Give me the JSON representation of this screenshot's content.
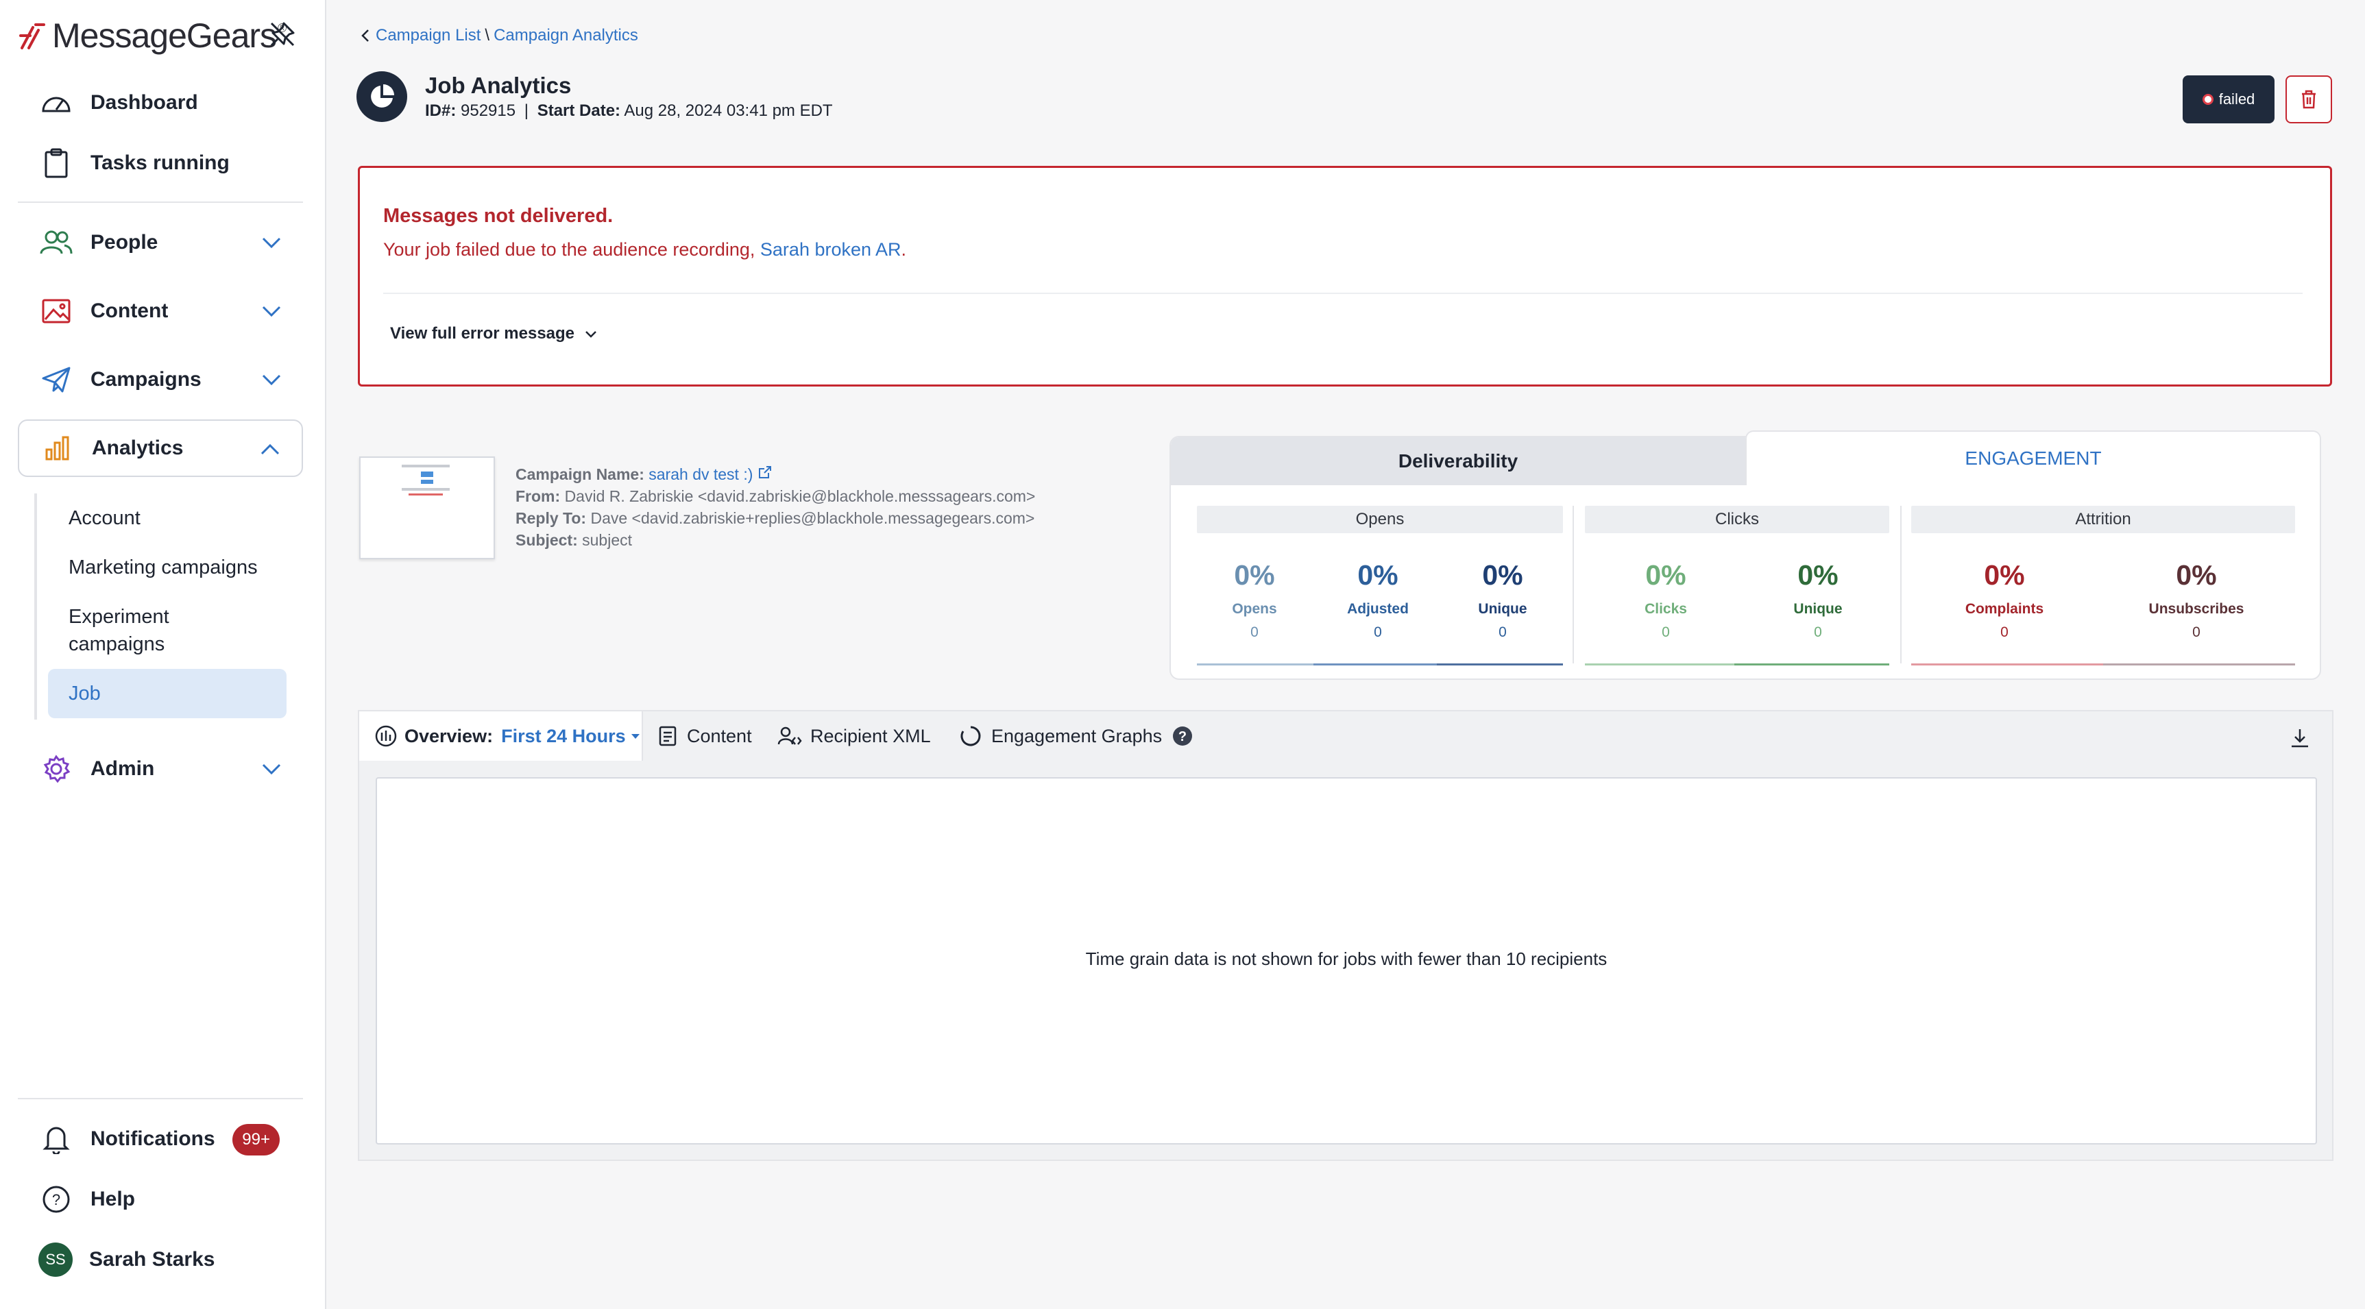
{
  "app": {
    "brand": "MessageGears",
    "brand_tm": "®"
  },
  "sidebar": {
    "top_items": [
      {
        "label": "Dashboard",
        "icon": "gauge-icon"
      },
      {
        "label": "Tasks running",
        "icon": "clipboard-icon"
      }
    ],
    "sections": [
      {
        "label": "People",
        "icon": "people-icon",
        "expanded": false
      },
      {
        "label": "Content",
        "icon": "image-icon",
        "expanded": false
      },
      {
        "label": "Campaigns",
        "icon": "paper-plane-icon",
        "expanded": false
      },
      {
        "label": "Analytics",
        "icon": "bar-chart-icon",
        "expanded": true
      },
      {
        "label": "Admin",
        "icon": "gear-icon",
        "expanded": false
      }
    ],
    "analytics_sub": [
      {
        "label": "Account"
      },
      {
        "label": "Marketing campaigns"
      },
      {
        "label": "Experiment campaigns"
      },
      {
        "label": "Job",
        "active": true
      }
    ],
    "bottom": {
      "notifications": "Notifications",
      "notifications_badge": "99+",
      "help": "Help",
      "user_initials": "SS",
      "user_name": "Sarah Starks"
    }
  },
  "breadcrumb": {
    "campaign_list": "Campaign List",
    "sep": "\\",
    "campaign_analytics": "Campaign Analytics"
  },
  "header": {
    "title": "Job Analytics",
    "id_label": "ID#:",
    "id_value": "952915",
    "meta_sep": "|",
    "start_label": "Start Date:",
    "start_value": "Aug 28, 2024 03:41 pm EDT",
    "status": "failed"
  },
  "error": {
    "title": "Messages not delivered.",
    "text_prefix": "Your job failed due to the audience recording, ",
    "link": "Sarah broken AR",
    "text_suffix": ".",
    "toggle": "View full error message"
  },
  "campaign": {
    "name_label": "Campaign Name:",
    "name_value": "sarah dv test :)",
    "from_label": "From:",
    "from_value": "David R. Zabriskie <david.zabriskie@blackhole.messsagears.com>",
    "reply_label": "Reply To:",
    "reply_value": "Dave <david.zabriskie+replies@blackhole.messagegears.com>",
    "subject_label": "Subject:",
    "subject_value": "subject"
  },
  "stats": {
    "tab_deliverability": "Deliverability",
    "tab_engagement": "ENGAGEMENT",
    "groups": [
      {
        "label": "Opens"
      },
      {
        "label": "Clicks"
      },
      {
        "label": "Attrition"
      }
    ],
    "items": [
      {
        "pct": "0%",
        "name": "Opens",
        "count": "0",
        "color": "#6a8fb0"
      },
      {
        "pct": "0%",
        "name": "Adjusted",
        "count": "0",
        "color": "#2d5f9a"
      },
      {
        "pct": "0%",
        "name": "Unique",
        "count": "0",
        "color": "#1f3f73"
      },
      {
        "pct": "0%",
        "name": "Clicks",
        "count": "0",
        "color": "#6fae7a"
      },
      {
        "pct": "0%",
        "name": "Unique",
        "count": "0",
        "color": "#2f6b3a"
      },
      {
        "pct": "0%",
        "name": "Complaints",
        "count": "0",
        "color": "#a3242b"
      },
      {
        "pct": "0%",
        "name": "Unsubscribes",
        "count": "0",
        "color": "#5a3136"
      }
    ]
  },
  "bottom_tabs": {
    "overview_label": "Overview:",
    "overview_value": "First 24 Hours",
    "content": "Content",
    "recipient_xml": "Recipient XML",
    "engagement_graphs": "Engagement Graphs",
    "empty_message": "Time grain data is not shown for jobs with fewer than 10 recipients"
  },
  "colors": {
    "accent": "#2f72c4",
    "danger": "#c5262f",
    "nav_active_bg": "#dde9f8"
  }
}
